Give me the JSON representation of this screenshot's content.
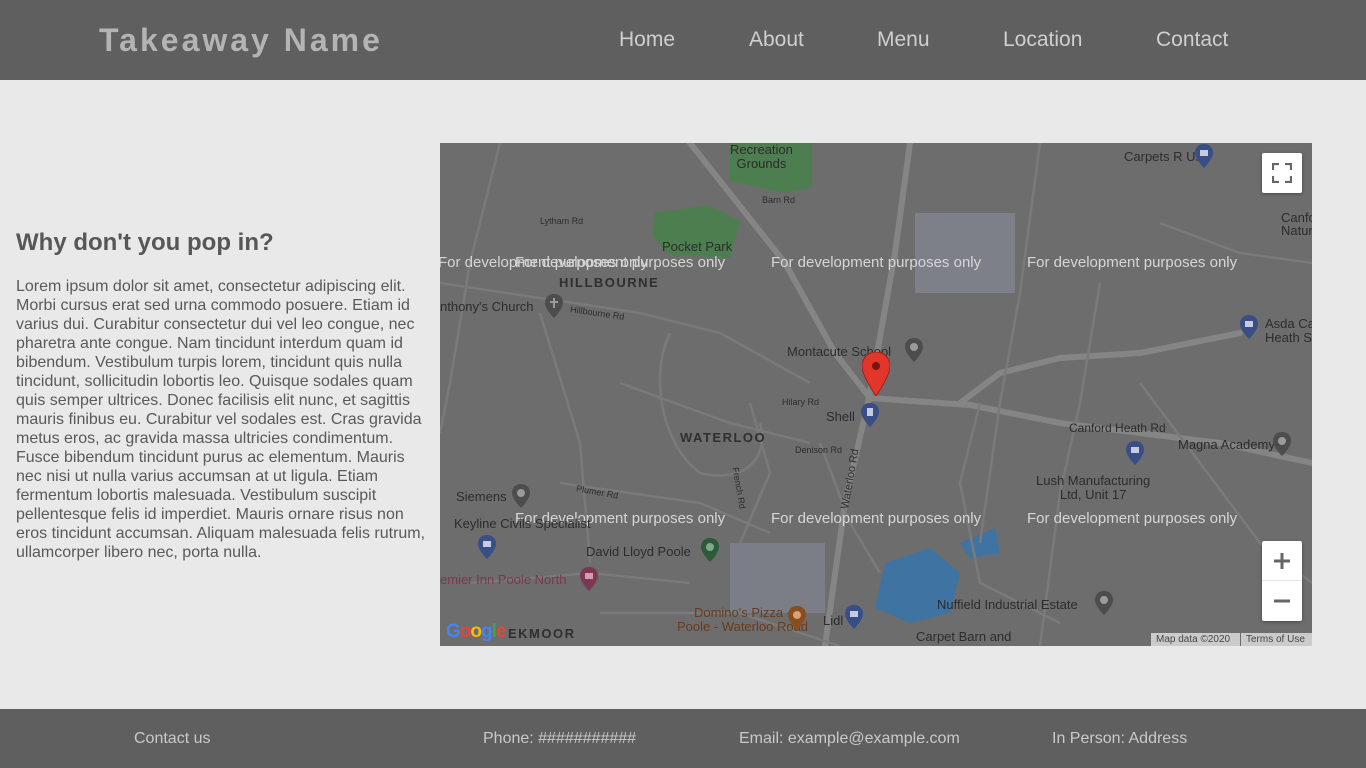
{
  "header": {
    "brand": "Takeaway Name",
    "nav": [
      "Home",
      "About",
      "Menu",
      "Location",
      "Contact"
    ]
  },
  "intro": {
    "title": "Why don't you pop in?",
    "text": "Lorem ipsum dolor sit amet, consectetur adipiscing elit. Morbi cursus erat sed urna commodo posuere. Etiam id varius dui. Curabitur consectetur dui vel leo congue, nec pharetra ante congue. Nam tincidunt interdum quam id bibendum. Vestibulum turpis lorem, tincidunt quis nulla tincidunt, sollicitudin lobortis leo. Quisque sodales quam quis semper ultrices. Donec facilisis elit nunc, et sagittis mauris finibus eu. Curabitur vel sodales est. Cras gravida metus eros, ac gravida massa ultricies condimentum. Fusce bibendum tincidunt purus ac elementum. Mauris nec nisi ut nulla varius accumsan at ut ligula. Etiam fermentum lobortis malesuada. Vestibulum suscipit pellentesque felis id imperdiet. Mauris ornare risus non eros tincidunt accumsan. Aliquam malesuada felis rutrum, ullamcorper libero nec, porta nulla."
  },
  "map": {
    "watermark": "For development purposes only",
    "places": {
      "recreation": "Recreation\nGrounds",
      "pocket_park": "Pocket Park",
      "montacute": "Montacute School",
      "shell": "Shell",
      "carpets": "Carpets R Us",
      "canford": "Canford\nNature",
      "asda": "Asda Ca\nHeath S",
      "magna": "Magna Academy",
      "canford_heath_rd": "Canford Heath Rd",
      "lush": "Lush Manufacturing\nLtd, Unit 17",
      "siemens": "Siemens",
      "keyline": "Keyline Civils Specialist",
      "david_lloyd": "David Lloyd Poole",
      "premier_inn": "emier Inn Poole North",
      "dominos": "Domino's Pizza -\nPoole - Waterloo Road",
      "lidl": "Lidl",
      "nuffield": "Nuffield Industrial Estate",
      "carpet_barn": "Carpet Barn and",
      "church": "nthony's Church"
    },
    "areas": {
      "hillbourne": "HILLBOURNE",
      "waterloo": "WATERLOO",
      "creekmoor": "EKMOOR"
    },
    "streets": {
      "waterloo_rd": "Waterloo Rd",
      "hillbourne_rd": "Hillbourne Rd",
      "lytham_rd": "Lytham Rd",
      "barn_rd": "Barn Rd",
      "denison_rd": "Denison Rd",
      "hilary_rd": "Hilary Rd",
      "plumer_rd": "Plumer Rd",
      "french_rd": "French Rd"
    },
    "attribution": "Map data ©2020",
    "terms": "Terms of Use",
    "logo": [
      "G",
      "o",
      "o",
      "g",
      "l",
      "e"
    ],
    "logo_colors": [
      "#4285f4",
      "#ea4335",
      "#fbbc05",
      "#4285f4",
      "#34a853",
      "#ea4335"
    ],
    "marker_color": "#e2352b",
    "icons": [
      "fullscreen-icon",
      "zoom-in-icon",
      "zoom-out-icon",
      "location-marker-icon"
    ]
  },
  "footer": {
    "contact": "Contact us",
    "phone": "Phone: ###########",
    "email": "Email: example@example.com",
    "address": "In Person: Address"
  }
}
